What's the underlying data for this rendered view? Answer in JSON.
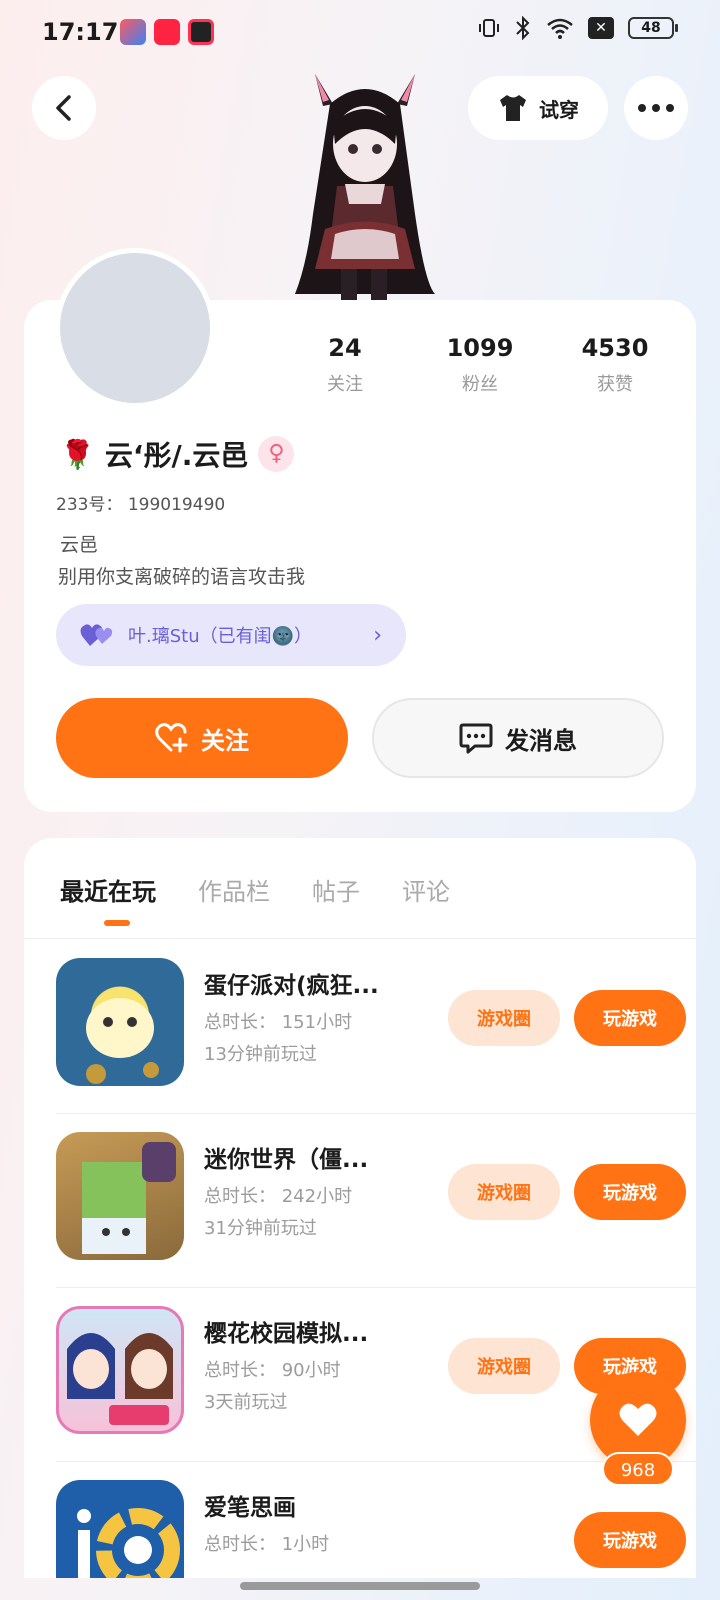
{
  "status_bar": {
    "time": "17:17",
    "app_icons": [
      "shortcut-app-icon",
      "xiaohongshu-icon",
      "record-app-icon"
    ],
    "battery": "48",
    "icons": [
      "vibrate-icon",
      "bluetooth-icon",
      "wifi-icon",
      "sim-off-icon",
      "battery-icon"
    ]
  },
  "header": {
    "back_icon": "chevron-left-icon",
    "tryon_label": "试穿",
    "more_icon": "more-dots-icon"
  },
  "profile": {
    "stats": [
      {
        "value": "24",
        "label": "关注"
      },
      {
        "value": "1099",
        "label": "粉丝"
      },
      {
        "value": "4530",
        "label": "获赞"
      }
    ],
    "nickname_emoji": "🌹",
    "nickname": "云‘彤/.云邑",
    "gender_symbol": "♀",
    "uid": "233号： 199019490",
    "bio_line1": "云邑",
    "bio_line2": "别用你支离破碎的语言攻击我",
    "cp_text": "叶.璃Stu（已有闺🌚）",
    "follow_label": "关注",
    "message_label": "发消息"
  },
  "tabs": [
    {
      "label": "最近在玩",
      "active": true
    },
    {
      "label": "作品栏",
      "active": false
    },
    {
      "label": "帖子",
      "active": false
    },
    {
      "label": "评论",
      "active": false
    }
  ],
  "games": [
    {
      "title": "蛋仔派对(疯狂...",
      "duration": "总时长： 151小时",
      "last_played": "13分钟前玩过",
      "circle_label": "游戏圈",
      "play_label": "玩游戏",
      "icon_colors": [
        "#2b5d8a",
        "#f5e06a"
      ]
    },
    {
      "title": "迷你世界（僵...",
      "duration": "总时长： 242小时",
      "last_played": "31分钟前玩过",
      "circle_label": "游戏圈",
      "play_label": "玩游戏",
      "icon_colors": [
        "#7bb661",
        "#b7e5f5"
      ]
    },
    {
      "title": "樱花校园模拟...",
      "duration": "总时长： 90小时",
      "last_played": "3天前玩过",
      "circle_label": "游戏圈",
      "play_label": "玩游戏",
      "icon_colors": [
        "#e86aa8",
        "#5a6fd0"
      ]
    },
    {
      "title": "爱笔思画",
      "duration": "总时长： 1小时",
      "last_played": "",
      "circle_label": "",
      "play_label": "玩游戏",
      "icon_colors": [
        "#1f5ea8",
        "#ffffff"
      ]
    }
  ],
  "like": {
    "count": "968"
  }
}
